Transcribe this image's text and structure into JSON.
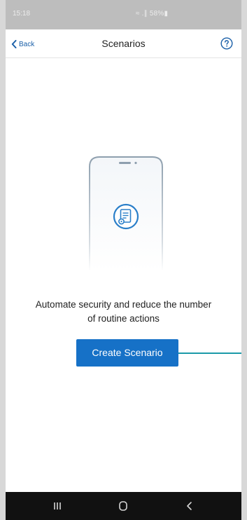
{
  "status_bar": {
    "time": "15:18",
    "indicators": "≈ .∥ 58%▮"
  },
  "nav": {
    "back_label": "Back",
    "title": "Scenarios",
    "help_icon": "help-circle-icon"
  },
  "empty_state": {
    "illustration_icon": "scenario-document-gear-icon",
    "message_line1": "Automate security and reduce the number",
    "message_line2": "of routine actions",
    "create_button_label": "Create Scenario"
  },
  "system_nav": {
    "recent_icon": "recent-apps-icon",
    "home_icon": "home-icon",
    "back_icon": "back-chevron-icon"
  },
  "colors": {
    "accent": "#1671c7",
    "link": "#1a5fa8",
    "callout": "#1b9aa8",
    "status_bar": "#bdbdbd",
    "system_nav": "#111111"
  }
}
